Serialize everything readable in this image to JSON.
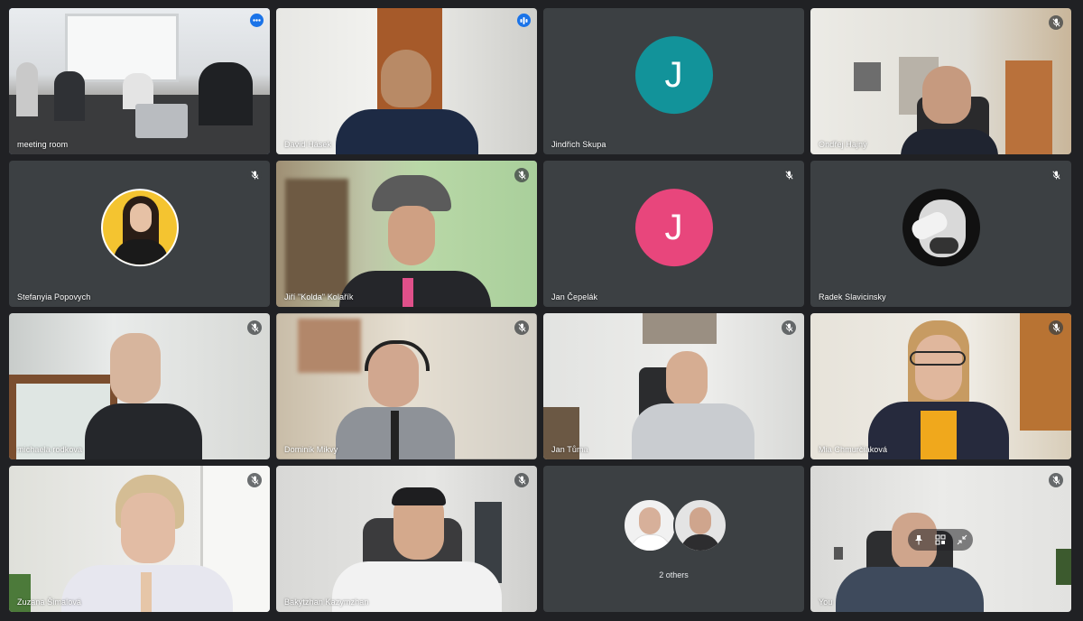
{
  "participants": [
    {
      "name": "meeting room"
    },
    {
      "name": "David Hásek"
    },
    {
      "name": "Jindřich Skupa",
      "initial": "J"
    },
    {
      "name": "Ondřej Hajný"
    },
    {
      "name": "Stefanyia Popovych"
    },
    {
      "name": "Jiří \"Kolda\" Kolařík"
    },
    {
      "name": "Jan Čepelák",
      "initial": "J"
    },
    {
      "name": "Radek Slavicinsky"
    },
    {
      "name": "michaela rodkova"
    },
    {
      "name": "Dominik Mikvy"
    },
    {
      "name": "Jan Tůma"
    },
    {
      "name": "Mia Chmurčiaková"
    },
    {
      "name": "Zuzana Šimalová"
    },
    {
      "name": "Bakytzhan Kazymzhan"
    },
    {
      "name": "",
      "others_label": "2 others"
    },
    {
      "name": "You"
    }
  ],
  "colors": {
    "background": "#202124",
    "tile": "#3c4043",
    "active_border": "#8ab4f8",
    "avatar_teal": "#12939a",
    "avatar_pink": "#e8467c",
    "badge_blue": "#1a73e8"
  },
  "icons": {
    "muted": "mic-off-icon",
    "more": "more-options-icon",
    "speaking": "audio-level-icon",
    "pin": "pin-icon",
    "frame": "frame-icon",
    "minimize": "minimize-icon"
  }
}
